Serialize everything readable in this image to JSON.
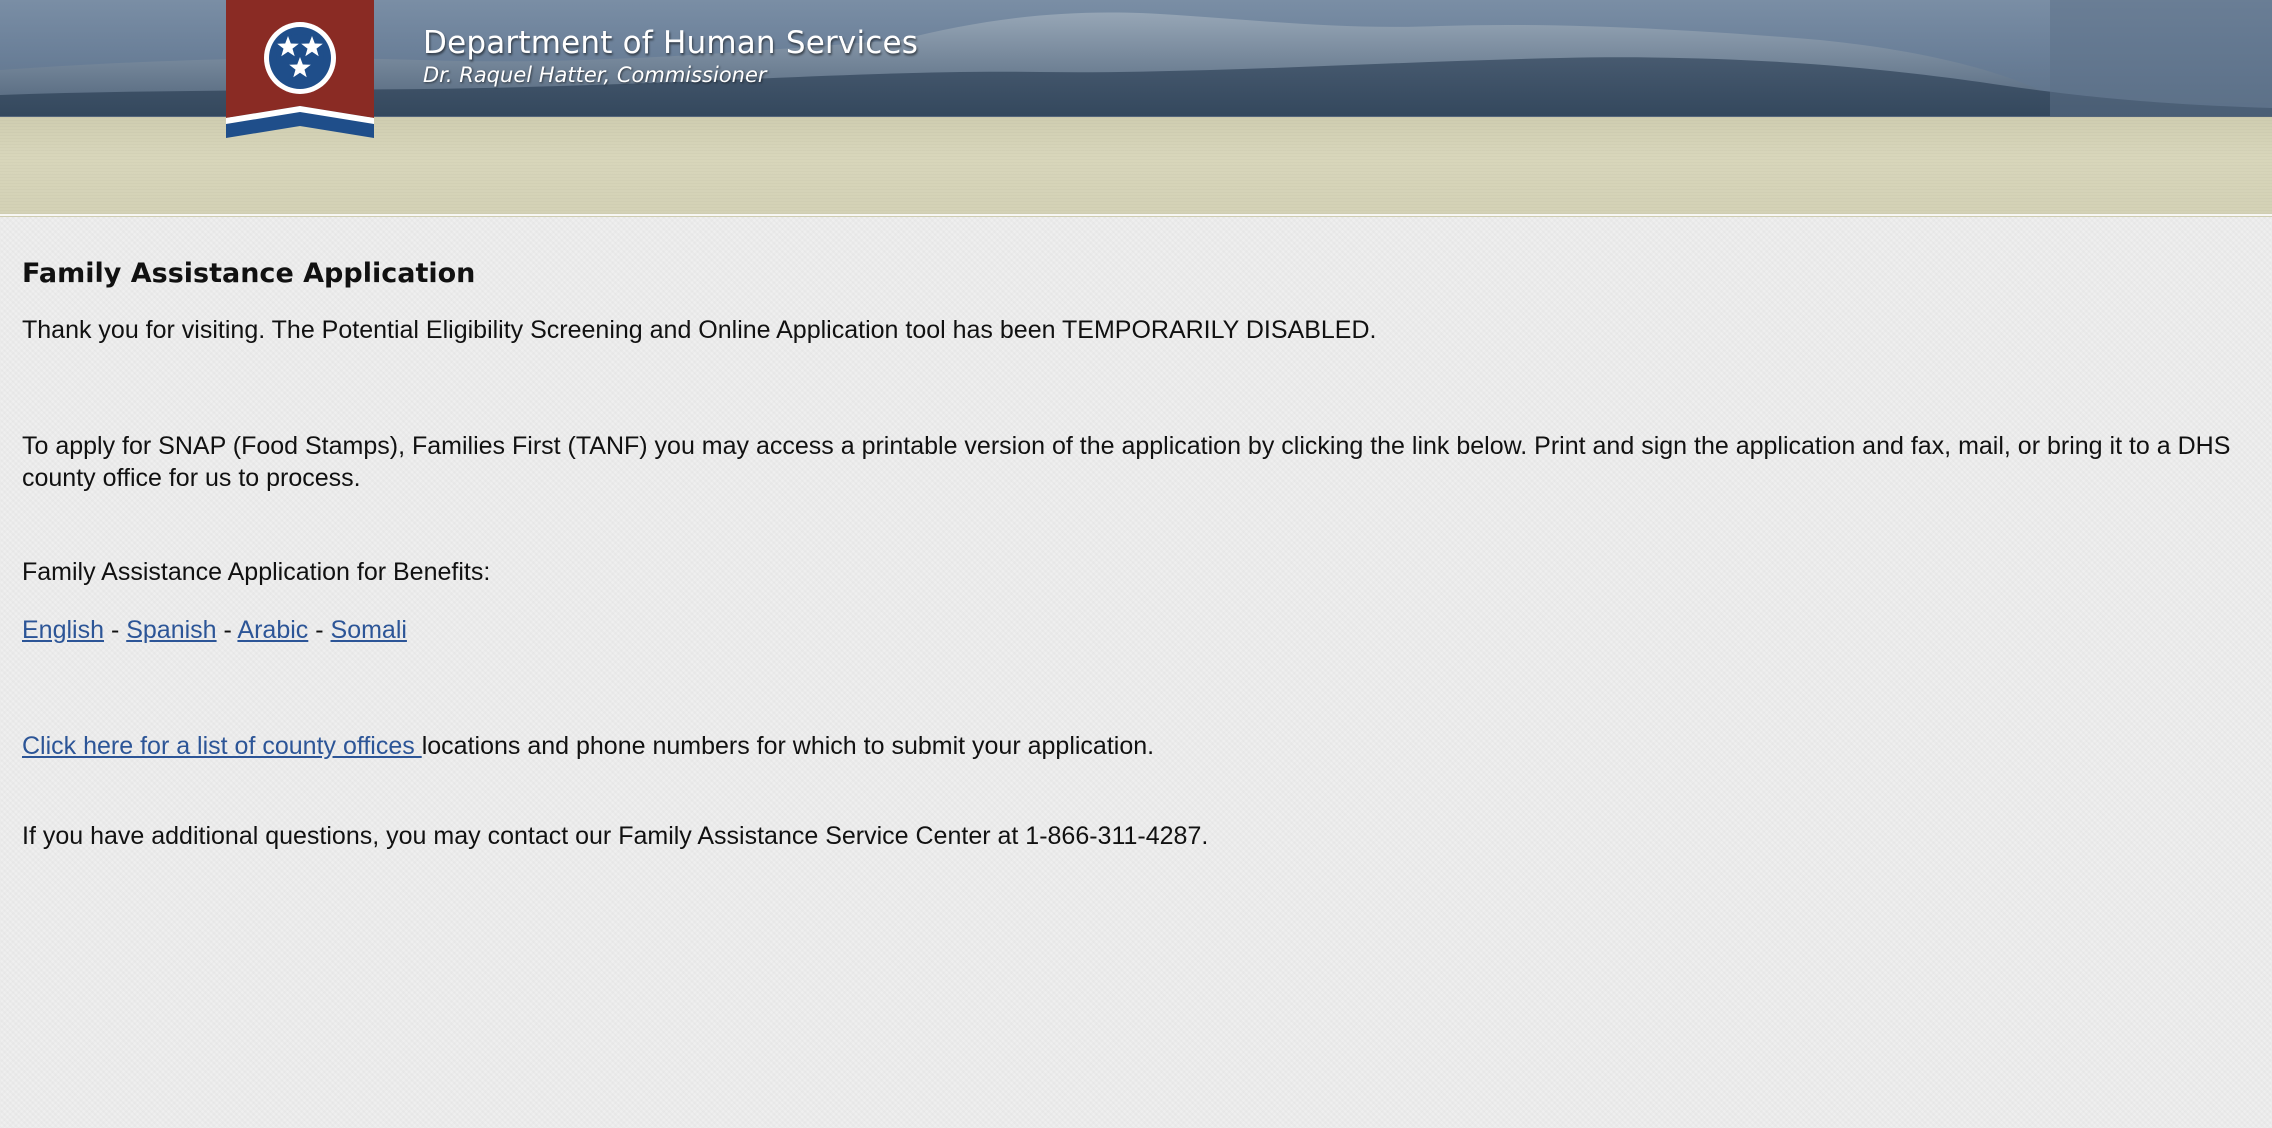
{
  "header": {
    "title": "Department of Human Services",
    "subtitle": "Dr. Raquel Hatter, Commissioner",
    "colors": {
      "sky": "#6b8099",
      "band": "#d6d4b8",
      "badge_red": "#8a2b24",
      "badge_blue": "#1f4e8a"
    }
  },
  "main": {
    "heading": "Family Assistance Application",
    "intro": {
      "text": "Thank you for visiting.  The Potential Eligibility Screening and Online Application tool has been ",
      "emphasis": "TEMPORARILY DISABLED",
      "end": "."
    },
    "apply_paragraph": "To apply for SNAP (Food Stamps), Families First (TANF) you may access a printable version of the application by clicking the link below.  Print and sign the application and fax, mail, or bring it to a DHS county office for us to process.",
    "benefits_label": "Family Assistance Application for Benefits:",
    "language_links": [
      {
        "label": "English"
      },
      {
        "label": "Spanish"
      },
      {
        "label": "Arabic"
      },
      {
        "label": "Somali"
      }
    ],
    "separator": " - ",
    "county_link": "Click here for a list of county offices ",
    "county_text": "locations and phone numbers for which to submit your application.",
    "contact_text": "If you have additional questions, you may contact our Family Assistance Service Center at 1-866-311-4287.",
    "link_color": "#2c5597"
  }
}
